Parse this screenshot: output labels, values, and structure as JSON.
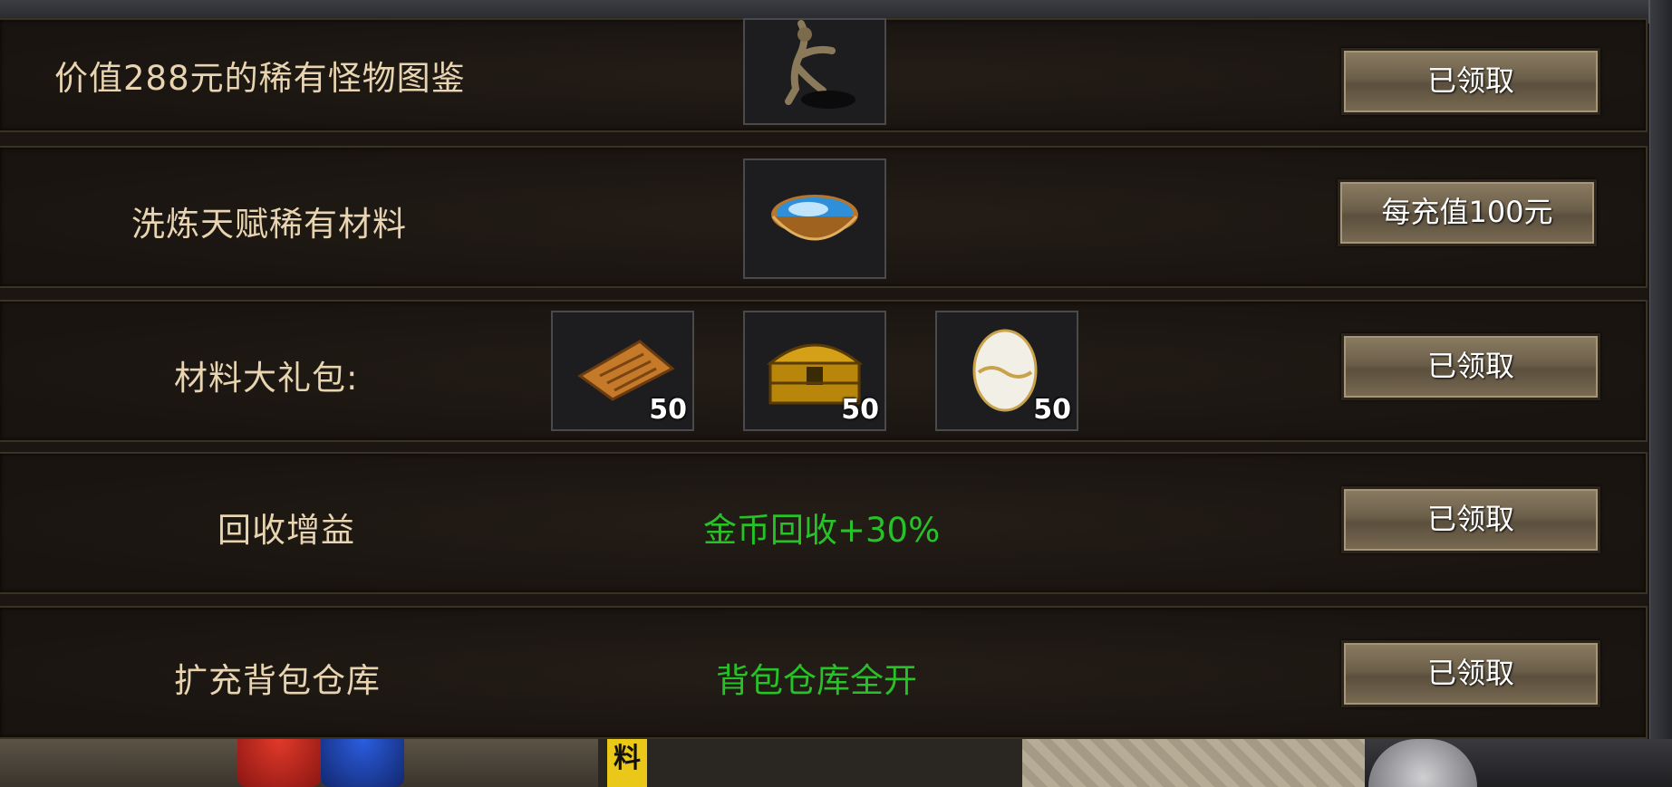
{
  "rows": [
    {
      "label": "价值288元的稀有怪物图鉴",
      "button": "已领取",
      "icon": "monster-figure-icon"
    },
    {
      "label": "洗炼天赋稀有材料",
      "button": "每充值100元",
      "icon": "blue-bowl-icon"
    },
    {
      "label": "材料大礼包:",
      "button": "已领取",
      "items": [
        {
          "icon": "scroll-icon",
          "count": "50"
        },
        {
          "icon": "treasure-chest-icon",
          "count": "50"
        },
        {
          "icon": "egg-icon",
          "count": "50"
        }
      ]
    },
    {
      "label": "回收增益",
      "bonus": "金币回收+30%",
      "button": "已领取"
    },
    {
      "label": "扩充背包仓库",
      "bonus": "背包仓库全开",
      "button": "已领取"
    }
  ],
  "hud": {
    "tag": "料"
  },
  "colors": {
    "label": "#e8d4b0",
    "bonus": "#27c227",
    "panel": "#1b1612"
  }
}
